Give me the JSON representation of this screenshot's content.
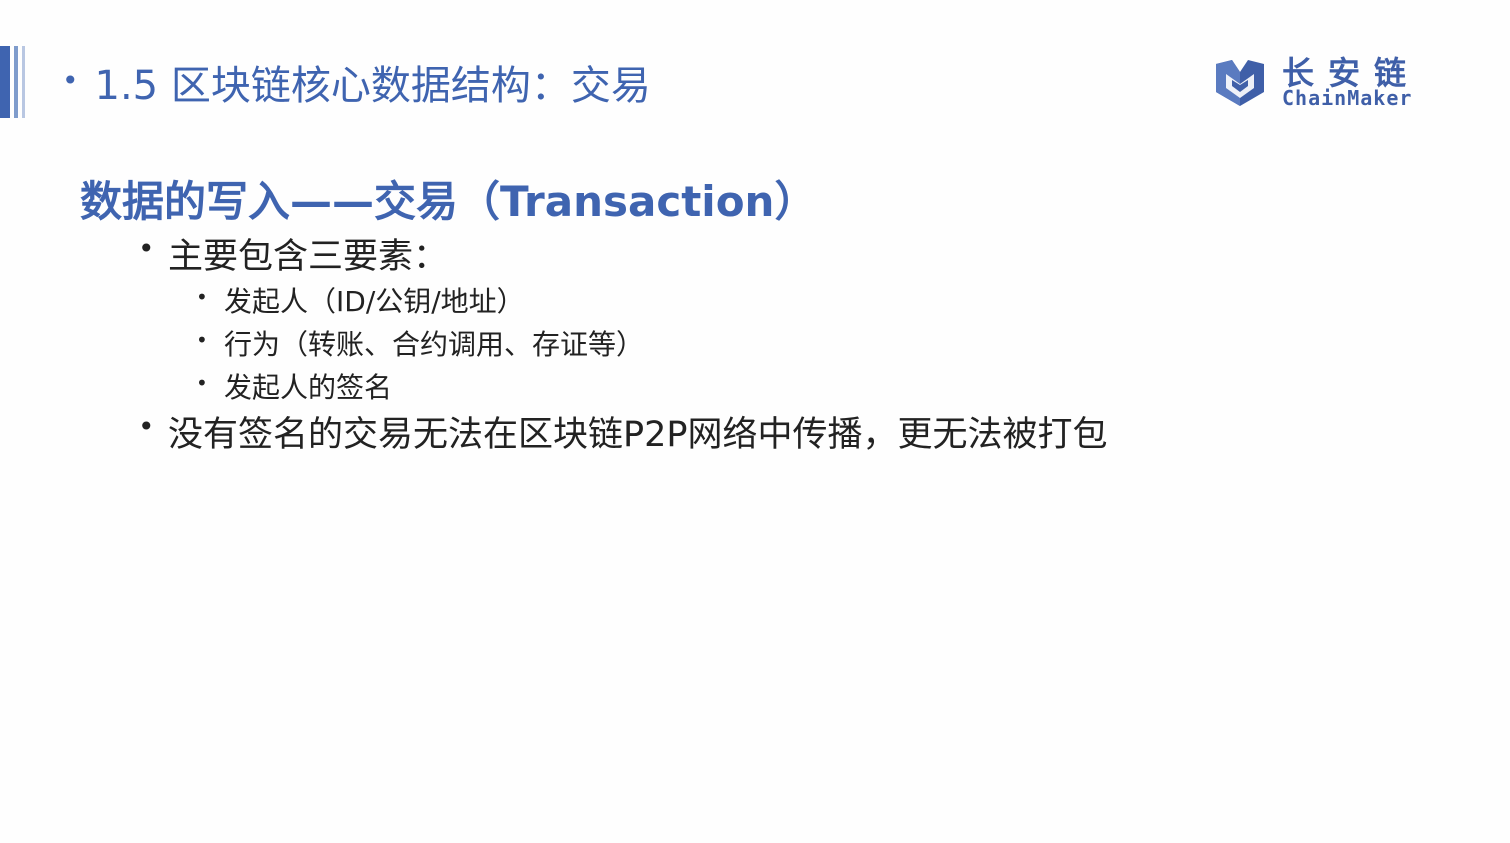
{
  "header": {
    "bullet": "•",
    "title": "1.5 区块链核心数据结构：交易"
  },
  "logo": {
    "name_cn": "长安链",
    "name_en": "ChainMaker",
    "icon": "chainmaker-logo-icon"
  },
  "section": {
    "title": "数据的写入——交易（Transaction）"
  },
  "bullets": [
    {
      "level": 1,
      "marker": "•",
      "text": "主要包含三要素："
    },
    {
      "level": 2,
      "marker": "•",
      "text": "发起人（ID/公钥/地址）"
    },
    {
      "level": 2,
      "marker": "•",
      "text": "行为（转账、合约调用、存证等）"
    },
    {
      "level": 2,
      "marker": "•",
      "text": "发起人的签名"
    },
    {
      "level": 1,
      "marker": "•",
      "text": "没有签名的交易无法在区块链P2P网络中传播，更无法被打包"
    }
  ],
  "colors": {
    "accent": "#3f64b0",
    "text": "#222222",
    "background": "#fefefe"
  }
}
